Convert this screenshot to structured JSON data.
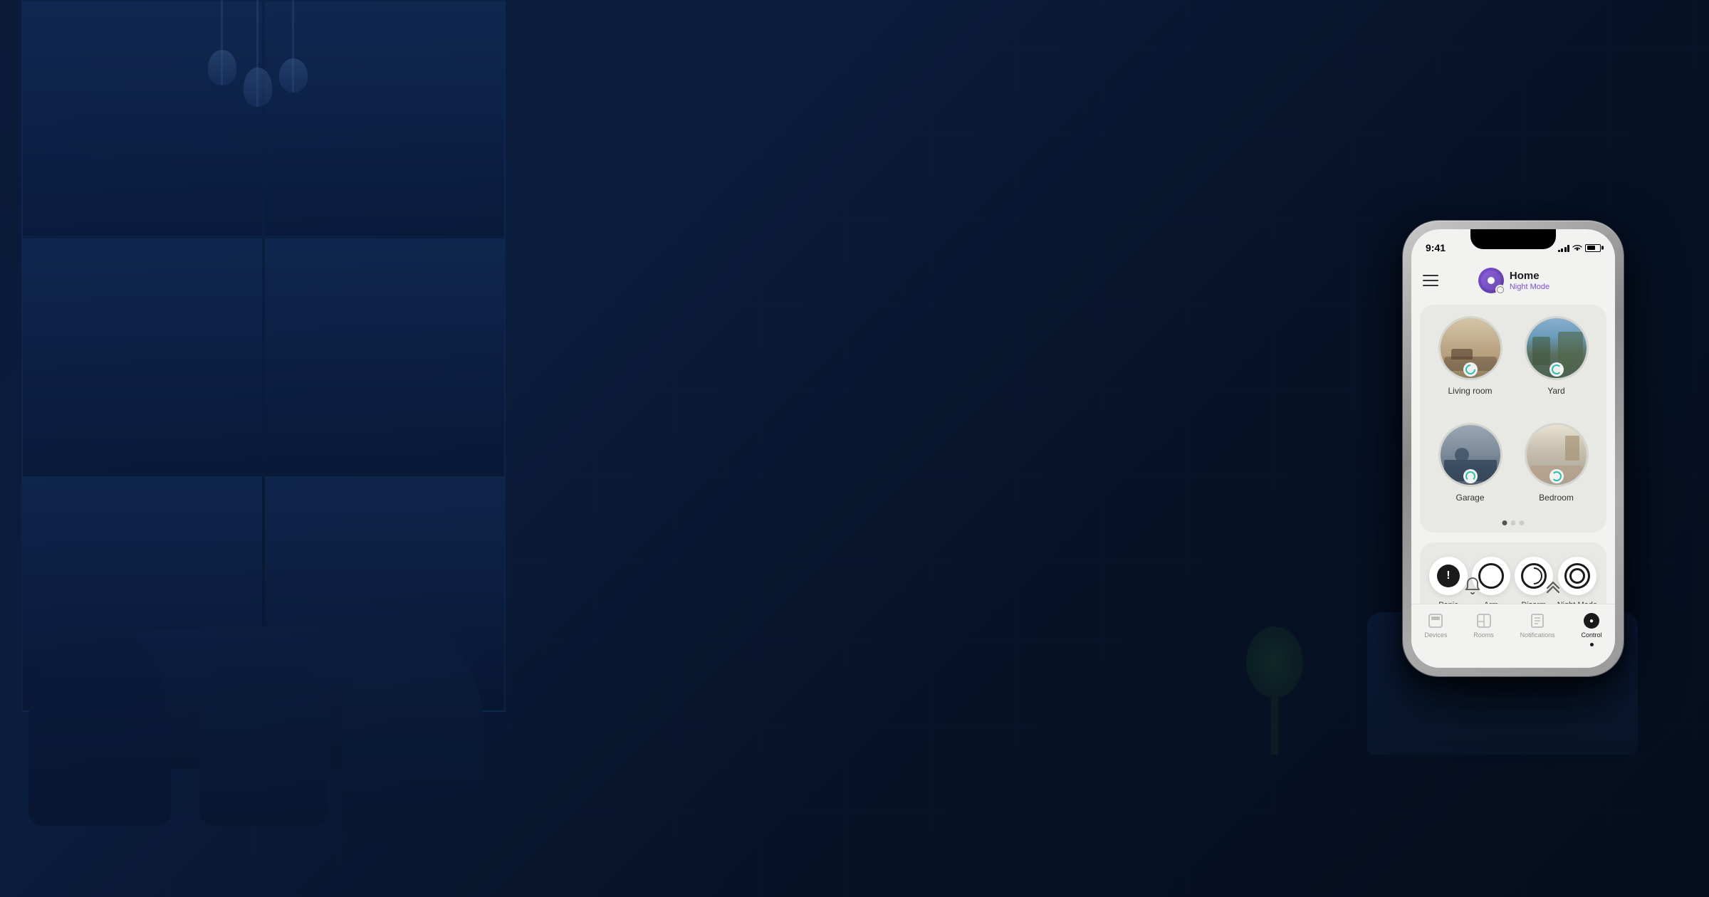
{
  "background": {
    "color": "#050e1f"
  },
  "phone": {
    "status_bar": {
      "time": "9:41",
      "signal": true,
      "wifi": true,
      "battery": "70"
    },
    "header": {
      "menu_label": "menu",
      "home_name": "Home",
      "mode": "Night Mode",
      "avatar_alt": "home avatar"
    },
    "rooms_card": {
      "rooms": [
        {
          "id": "living-room",
          "name": "Living room"
        },
        {
          "id": "yard",
          "name": "Yard"
        },
        {
          "id": "garage",
          "name": "Garage"
        },
        {
          "id": "bedroom",
          "name": "Bedroom"
        }
      ],
      "pagination": {
        "total": 3,
        "active": 0
      }
    },
    "security_card": {
      "controls": [
        {
          "id": "panic",
          "label": "Panic",
          "icon": "panic-icon"
        },
        {
          "id": "arm",
          "label": "Arm",
          "icon": "arm-icon"
        },
        {
          "id": "disarm",
          "label": "Disarm",
          "icon": "disarm-icon"
        },
        {
          "id": "night-mode",
          "label": "Night Mode",
          "icon": "nightmode-icon"
        }
      ]
    },
    "tab_bar": {
      "tabs": [
        {
          "id": "devices",
          "label": "Devices",
          "active": false
        },
        {
          "id": "rooms",
          "label": "Rooms",
          "active": false
        },
        {
          "id": "notifications",
          "label": "Notifications",
          "active": false
        },
        {
          "id": "control",
          "label": "Control",
          "active": true
        }
      ]
    }
  }
}
